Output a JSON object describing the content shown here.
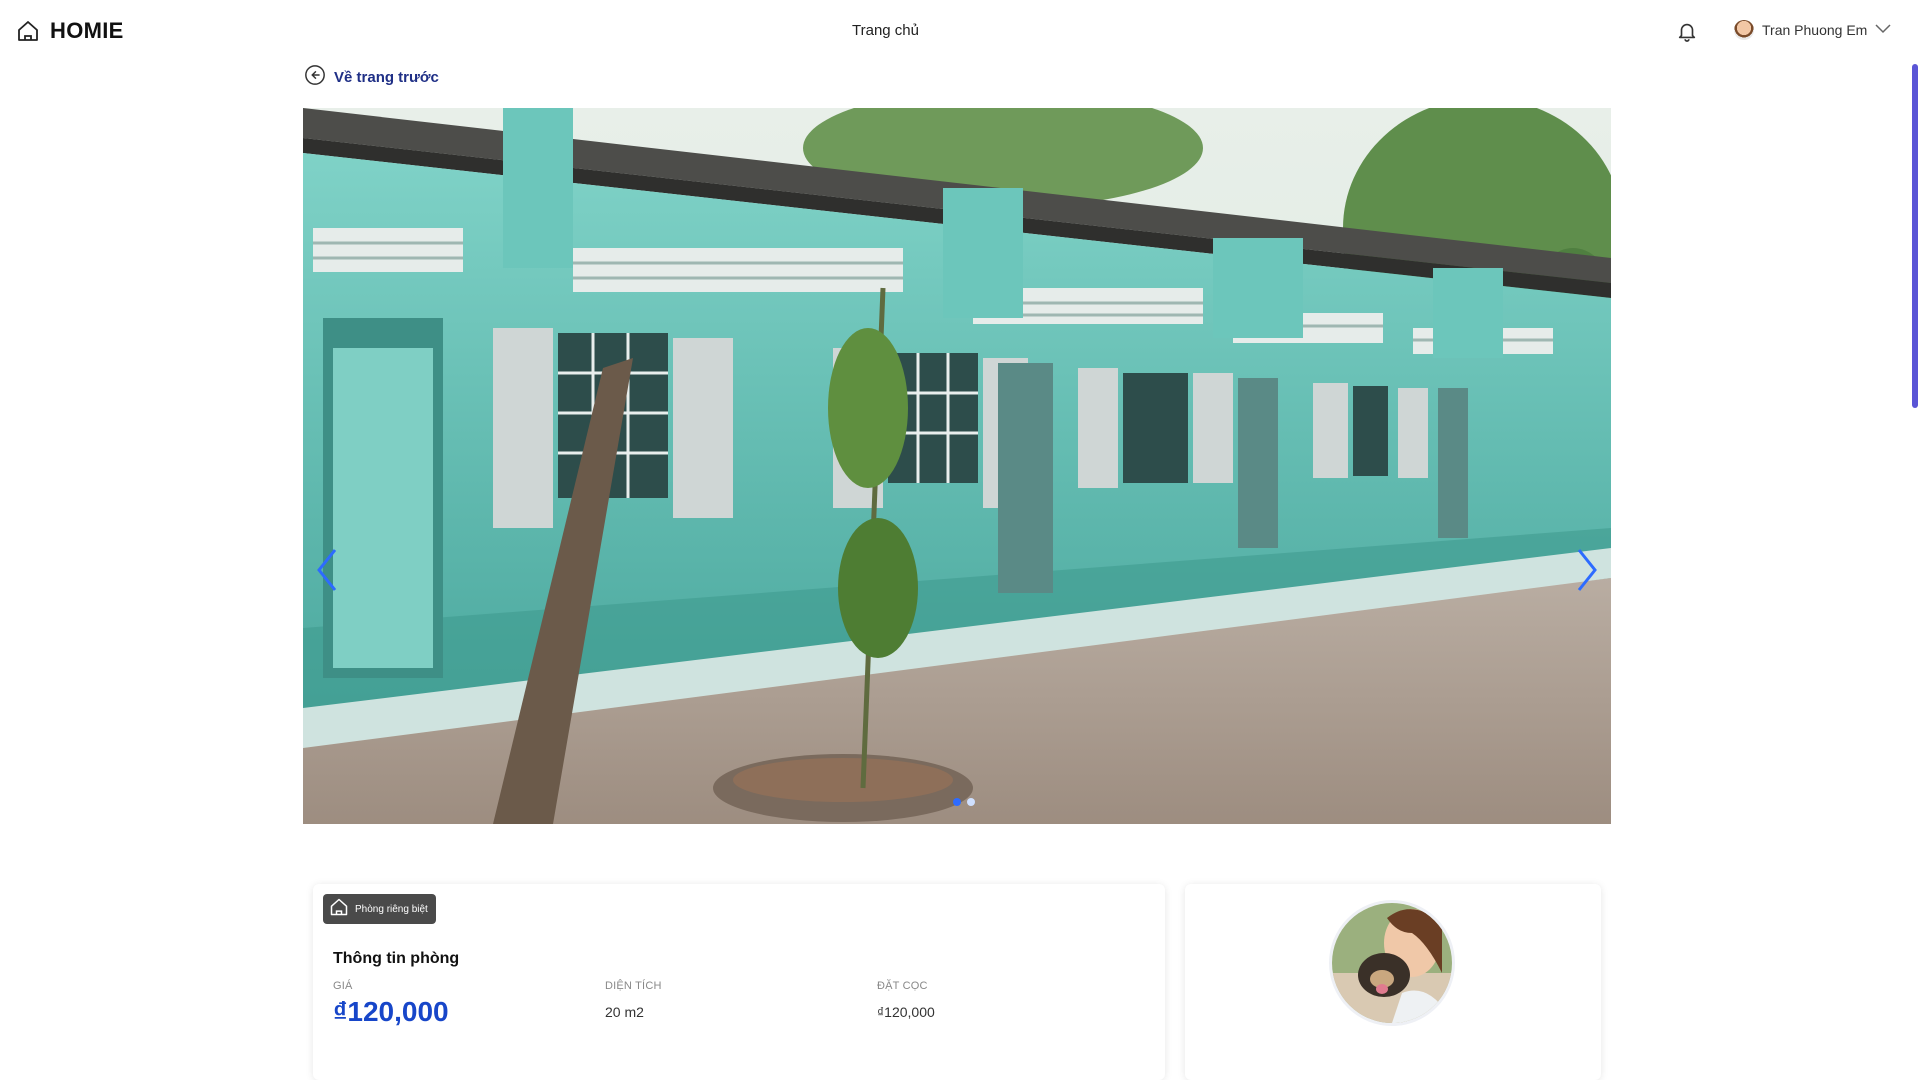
{
  "header": {
    "logo_text": "HOMIE",
    "nav_home": "Trang chủ",
    "user_name": "Tran Phuong Em"
  },
  "back_link": {
    "label": "Về trang trước"
  },
  "carousel": {
    "slide_count": 2,
    "active_index": 0
  },
  "room": {
    "type_badge": "Phòng riêng biệt",
    "section_title": "Thông tin phòng",
    "fields": [
      {
        "label": "GIÁ",
        "value": "₫120,000"
      },
      {
        "label": "DIỆN TÍCH",
        "value": "20 m2"
      },
      {
        "label": "ĐẶT CỌC",
        "value": "₫120,000"
      }
    ]
  },
  "colors": {
    "accent_blue": "#1746c9",
    "back_link": "#1f2f86",
    "scrollbar": "#5a55d6"
  }
}
